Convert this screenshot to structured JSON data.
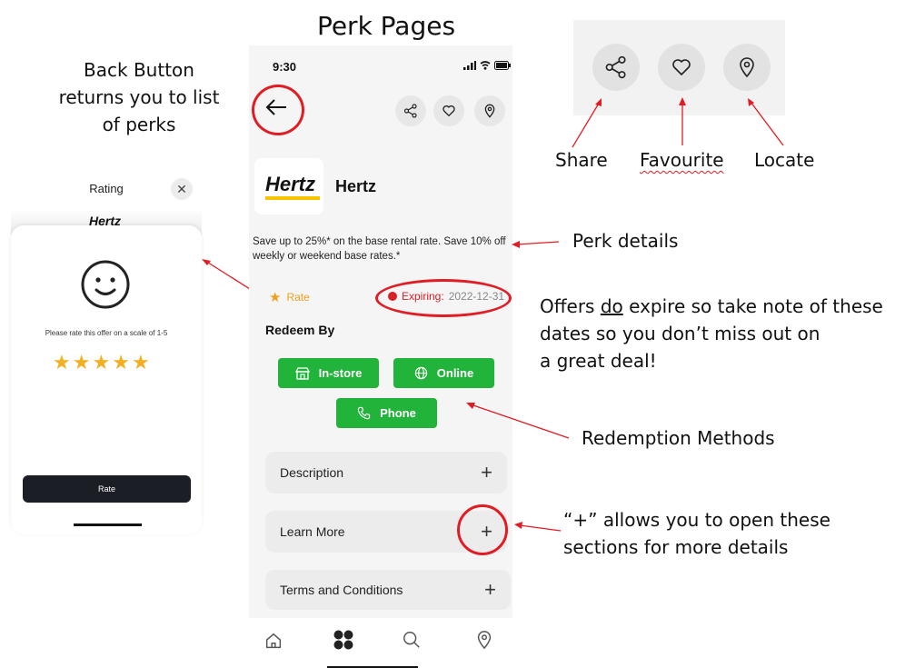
{
  "title": "Perk Pages",
  "annotations": {
    "back_button_line1": "Back Button",
    "back_button_line2": "returns you to list",
    "back_button_line3": "of perks",
    "share": "Share",
    "favourite": "Favourite",
    "locate": "Locate",
    "perk_details": "Perk details",
    "expire_part1": "Offers ",
    "expire_underlined": "do",
    "expire_part2": " expire so take note of these",
    "expire_line2": "dates so you don’t miss out on",
    "expire_line3": "a great deal!",
    "redemption_methods": "Redemption Methods",
    "plus_line1": "“+” allows you to open these",
    "plus_line2": "sections for more details"
  },
  "rating_modal": {
    "title": "Rating",
    "close_icon": "close-icon",
    "logo_text": "Hertz",
    "smiley_icon": "smiley-icon",
    "prompt": "Please rate this offer on a scale of 1-5",
    "stars": 5,
    "star_color": "#f2b022",
    "rate_button": "Rate"
  },
  "phone": {
    "status_time": "9:30",
    "header_icons": [
      "share-icon",
      "heart-icon",
      "location-icon"
    ],
    "brand_logo": "Hertz",
    "brand_name": "Hertz",
    "description": "Save up to 25%* on the base rental rate.  Save 10% off weekly or weekend base rates.*",
    "rate_label": "Rate",
    "expiring_label": "Expiring:",
    "expiring_date": "2022-12-31",
    "redeem_by": "Redeem By",
    "buttons": {
      "in_store": "In-store",
      "online": "Online",
      "phone": "Phone"
    },
    "sections": [
      "Description",
      "Learn More",
      "Terms and Conditions"
    ],
    "nav_icons": [
      "home-icon",
      "grid-icon",
      "search-icon",
      "location-icon"
    ]
  },
  "colors": {
    "accent_green": "#22b33a",
    "annotation_red": "#e01c24",
    "rate_orange": "#f2a01c",
    "expiring_red": "#d92027"
  }
}
